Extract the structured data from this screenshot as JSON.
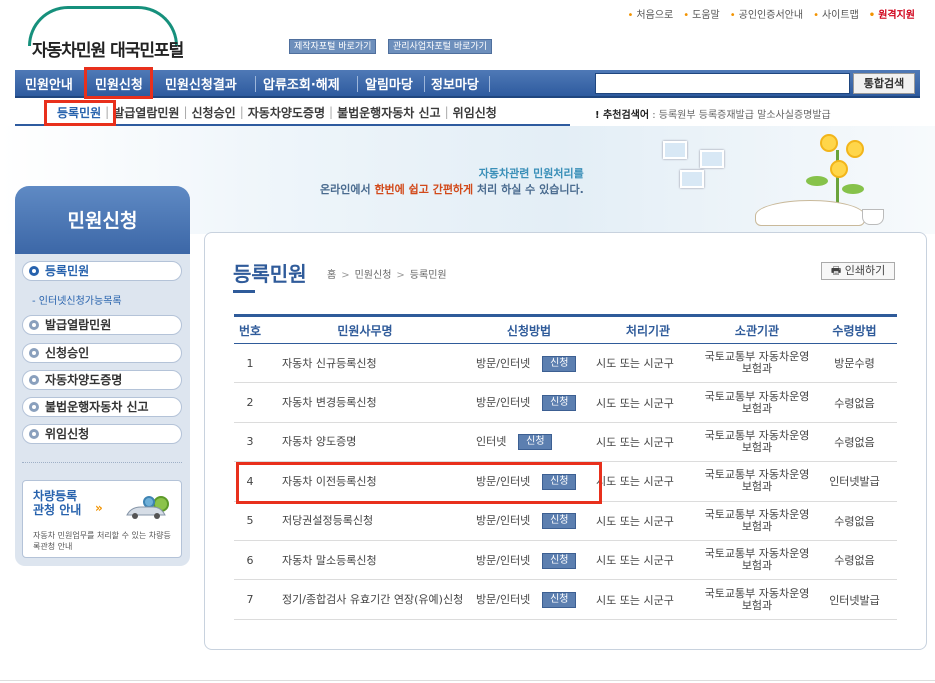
{
  "header": {
    "logo_text": "자동차민원 대국민포털",
    "quick_links": [
      "제작자포털 바로가기",
      "관리사업자포털 바로가기"
    ],
    "util_links": [
      "처음으로",
      "도움말",
      "공인인증서안내",
      "사이트맵",
      "원격지원"
    ]
  },
  "nav": {
    "items": [
      "민원안내",
      "민원신청",
      "민원신청결과",
      "압류조회·해제",
      "알림마당",
      "정보마당"
    ],
    "search_placeholder": "",
    "search_button": "통합검색"
  },
  "subnav": {
    "items": [
      "등록민원",
      "발급열람민원",
      "신청승인",
      "자동차양도증명",
      "불법운행자동차 신고",
      "위임신청"
    ],
    "recommend_label": "추천검색어",
    "recommend_items": "등록원부   등록증재발급   말소사실증명발급"
  },
  "banner": {
    "line1": "자동차관련 민원처리를",
    "line2_a": "온라인에서 ",
    "line2_em": "한번에 쉽고 간편하게",
    "line2_b": " 처리 하실 수 있습니다."
  },
  "sidebar": {
    "title": "민원신청",
    "items": [
      "등록민원",
      "발급열람민원",
      "신청승인",
      "자동차양도증명",
      "불법운행자동차 신고",
      "위임신청"
    ],
    "sub_item": "인터넷신청가능목록",
    "info_box": {
      "title": "차량등록\n관청 안내",
      "arrow": "»",
      "desc": "자동차 민원업무를 처리할 수 있는 차량등록관청 안내"
    }
  },
  "content": {
    "title": "등록민원",
    "breadcrumb": [
      "홈",
      "민원신청",
      "등록민원"
    ],
    "print_button": "인쇄하기",
    "columns": [
      "번호",
      "민원사무명",
      "신청방법",
      "처리기관",
      "소관기관",
      "수령방법"
    ],
    "apply_label": "신청",
    "rows": [
      {
        "no": "1",
        "name": "자동차 신규등록신청",
        "method": "방문/인터넷",
        "proc": "시도 또는 시군구",
        "org": "국토교통부 자동차운영보험과",
        "recv": "방문수령"
      },
      {
        "no": "2",
        "name": "자동차 변경등록신청",
        "method": "방문/인터넷",
        "proc": "시도 또는 시군구",
        "org": "국토교통부 자동차운영보험과",
        "recv": "수령없음"
      },
      {
        "no": "3",
        "name": "자동차 양도증명",
        "method": "인터넷",
        "proc": "시도 또는 시군구",
        "org": "국토교통부 자동차운영보험과",
        "recv": "수령없음"
      },
      {
        "no": "4",
        "name": "자동차 이전등록신청",
        "method": "방문/인터넷",
        "proc": "시도 또는 시군구",
        "org": "국토교통부 자동차운영보험과",
        "recv": "인터넷발급"
      },
      {
        "no": "5",
        "name": "저당권설정등록신청",
        "method": "방문/인터넷",
        "proc": "시도 또는 시군구",
        "org": "국토교통부 자동차운영보험과",
        "recv": "수령없음"
      },
      {
        "no": "6",
        "name": "자동차 말소등록신청",
        "method": "방문/인터넷",
        "proc": "시도 또는 시군구",
        "org": "국토교통부 자동차운영보험과",
        "recv": "수령없음"
      },
      {
        "no": "7",
        "name": "정기/종합검사 유효기간 연장(유예)신청",
        "method": "방문/인터넷",
        "proc": "시도 또는 시군구",
        "org": "국토교통부 자동차운영보험과",
        "recv": "인터넷발급"
      }
    ]
  },
  "colors": {
    "brand_blue": "#2f5b9a",
    "nav_blue": "#3c67a7",
    "highlight_red": "#e8301c",
    "accent_orange": "#f29300"
  }
}
